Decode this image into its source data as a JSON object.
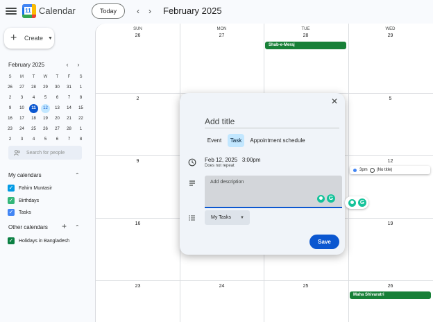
{
  "header": {
    "app_title": "Calendar",
    "logo_number": "11",
    "today_label": "Today",
    "prev_label": "‹",
    "next_label": "›",
    "month_label": "February 2025"
  },
  "sidebar": {
    "create_label": "Create",
    "mini_calendar": {
      "title": "February 2025",
      "prev": "‹",
      "next": "›",
      "weekdays": [
        "S",
        "M",
        "T",
        "W",
        "T",
        "F",
        "S"
      ],
      "weeks": [
        [
          "26",
          "27",
          "28",
          "29",
          "30",
          "31",
          "1"
        ],
        [
          "2",
          "3",
          "4",
          "5",
          "6",
          "7",
          "8"
        ],
        [
          "9",
          "10",
          "11",
          "12",
          "13",
          "14",
          "15"
        ],
        [
          "16",
          "17",
          "18",
          "19",
          "20",
          "21",
          "22"
        ],
        [
          "23",
          "24",
          "25",
          "26",
          "27",
          "28",
          "1"
        ],
        [
          "2",
          "3",
          "4",
          "5",
          "6",
          "7",
          "8"
        ]
      ],
      "today": "11",
      "selected": "12"
    },
    "search_placeholder": "Search for people",
    "my_calendars_title": "My calendars",
    "my_calendars": [
      {
        "label": "Fahim Muntasir",
        "color": "#039be5"
      },
      {
        "label": "Birthdays",
        "color": "#33b679"
      },
      {
        "label": "Tasks",
        "color": "#4285f4"
      }
    ],
    "other_calendars_title": "Other calendars",
    "other_calendars": [
      {
        "label": "Holidays in Bangladesh",
        "color": "#0b8043"
      }
    ]
  },
  "grid": {
    "weekdays": [
      "SUN",
      "MON",
      "TUE",
      "WED"
    ],
    "weeks": [
      [
        "26",
        "27",
        "28",
        "29"
      ],
      [
        "2",
        "",
        "",
        "5"
      ],
      [
        "9",
        "",
        "",
        "12"
      ],
      [
        "16",
        "",
        "",
        "19"
      ],
      [
        "23",
        "24",
        "25",
        "26"
      ]
    ],
    "events": {
      "shab_e_meraj": "Shab-e-Meraj",
      "maha_shivaratri": "Maha Shivaratri",
      "task_time": "3pm",
      "task_title": "(No title)"
    }
  },
  "dialog": {
    "title_placeholder": "Add title",
    "tabs": [
      "Event",
      "Task",
      "Appointment schedule"
    ],
    "active_tab": "Task",
    "date": "Feb 12, 2025",
    "time": "3:00pm",
    "repeat": "Does not repeat",
    "description_placeholder": "Add description",
    "task_list": "My Tasks",
    "save_label": "Save",
    "close_label": "✕",
    "grammarly_letter": "G"
  },
  "colors": {
    "holiday_event": "#188038",
    "primary": "#0b57d0",
    "active_tab": "#c2e7ff"
  }
}
